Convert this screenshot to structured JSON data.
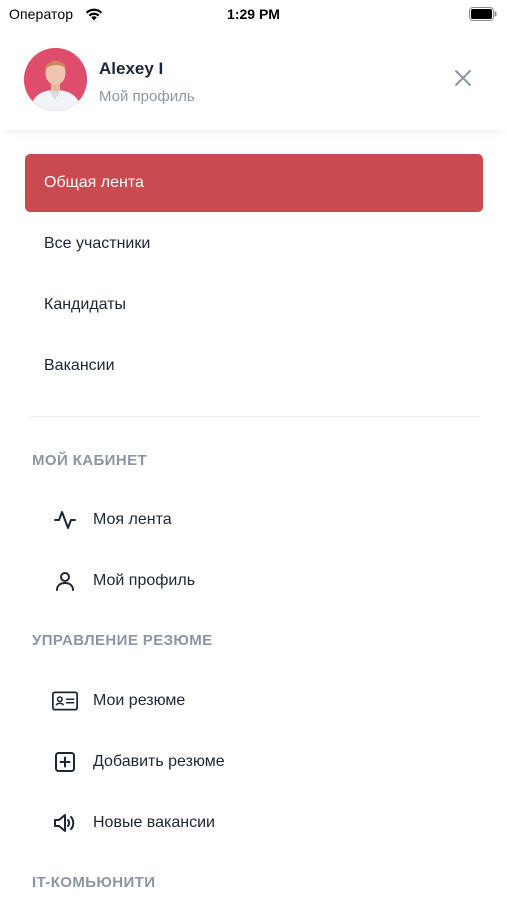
{
  "status_bar": {
    "carrier": "Оператор",
    "time": "1:29 PM"
  },
  "header": {
    "user_name": "Alexey I",
    "user_subtitle": "Мой профиль"
  },
  "menu": {
    "items": [
      {
        "label": "Общая лента",
        "active": true
      },
      {
        "label": "Все участники",
        "active": false
      },
      {
        "label": "Кандидаты",
        "active": false
      },
      {
        "label": "Вакансии",
        "active": false
      }
    ]
  },
  "sections": [
    {
      "title": "МОЙ КАБИНЕТ",
      "items": [
        {
          "label": "Моя лента",
          "icon": "activity-icon"
        },
        {
          "label": "Мой профиль",
          "icon": "user-icon"
        }
      ]
    },
    {
      "title": "УПРАВЛЕНИЕ РЕЗЮМЕ",
      "items": [
        {
          "label": "Мои резюме",
          "icon": "id-card-icon"
        },
        {
          "label": "Добавить резюме",
          "icon": "plus-square-icon"
        },
        {
          "label": "Новые вакансии",
          "icon": "megaphone-icon"
        }
      ]
    },
    {
      "title": "IT-КОМЬЮНИТИ",
      "items": []
    }
  ],
  "colors": {
    "accent": "#c94a4f",
    "text": "#1c2636",
    "muted": "#8c96a3"
  }
}
